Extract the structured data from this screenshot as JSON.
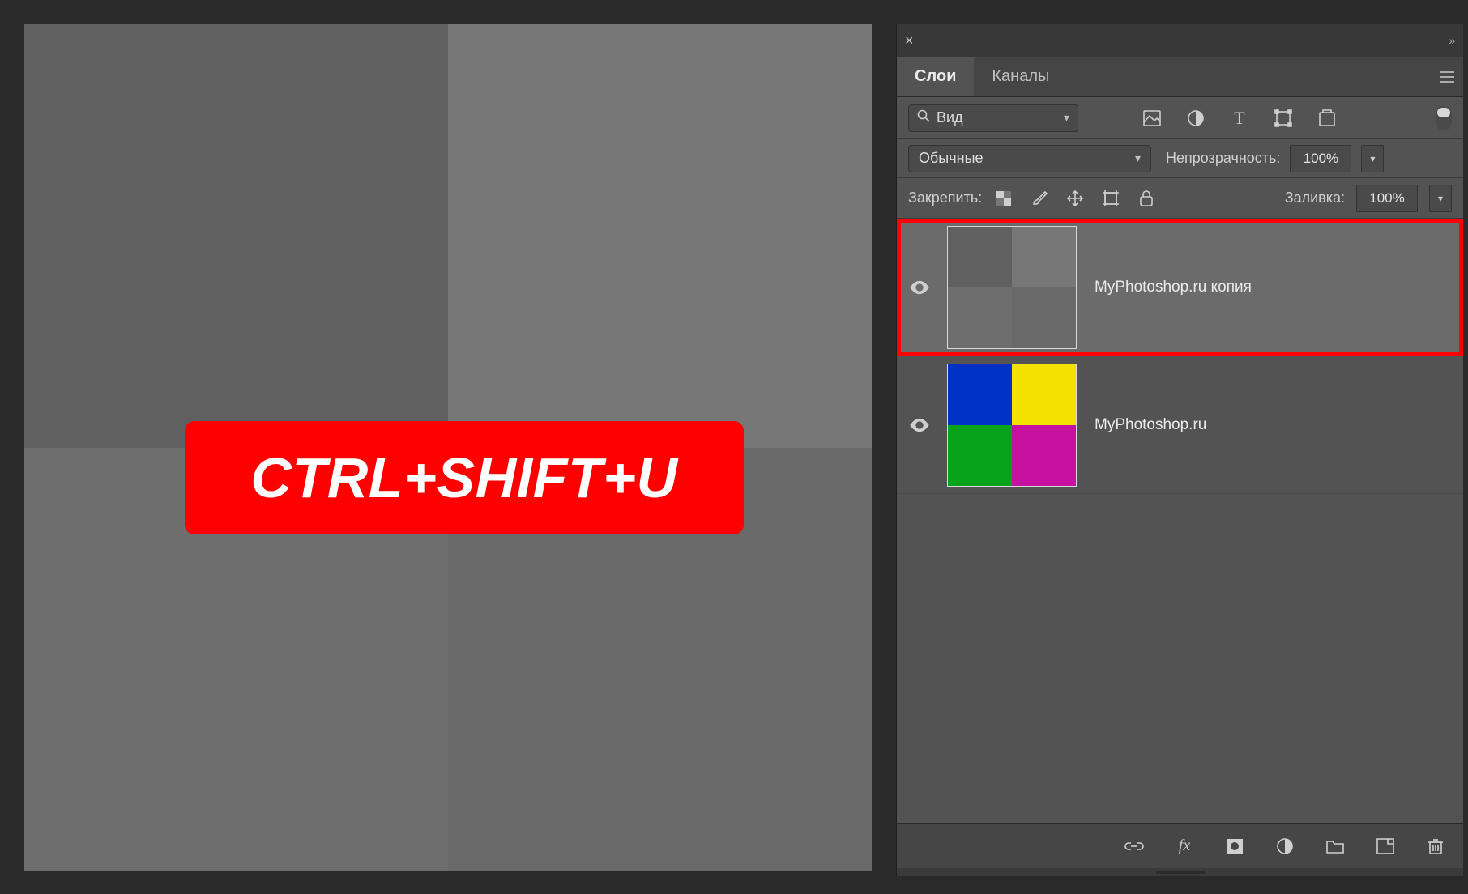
{
  "canvas": {
    "overlay_text": "CTRL+SHIFT+U",
    "quadrant_colors_gray": [
      "#606060",
      "#777777",
      "#6e6e6e",
      "#696969"
    ]
  },
  "panel": {
    "tabs": {
      "active": "Слои",
      "items": [
        "Слои",
        "Каналы"
      ]
    },
    "search": {
      "label": "Вид"
    },
    "blend": {
      "mode": "Обычные",
      "opacity_label": "Непрозрачность:",
      "opacity_value": "100%"
    },
    "lock": {
      "label": "Закрепить:",
      "fill_label": "Заливка:",
      "fill_value": "100%"
    },
    "layers": [
      {
        "name": "MyPhotoshop.ru копия",
        "selected": true,
        "visible": true,
        "thumb": "gray"
      },
      {
        "name": "MyPhotoshop.ru",
        "selected": false,
        "visible": true,
        "thumb": "color"
      }
    ],
    "colors": {
      "highlight": "#ff0000",
      "thumb_color_quadrants": [
        "#0032c7",
        "#f3e100",
        "#07a31a",
        "#c610a0"
      ]
    },
    "icons": {
      "filter": [
        "image-icon",
        "adjustment-icon",
        "type-icon",
        "shape-icon",
        "smartobject-icon"
      ],
      "lock": [
        "lock-pixels-icon",
        "lock-brush-icon",
        "lock-move-icon",
        "lock-artboard-icon",
        "lock-all-icon"
      ],
      "bottom": [
        "link-icon",
        "fx-icon",
        "mask-icon",
        "adjustment-layer-icon",
        "group-icon",
        "new-layer-icon",
        "trash-icon"
      ]
    }
  }
}
